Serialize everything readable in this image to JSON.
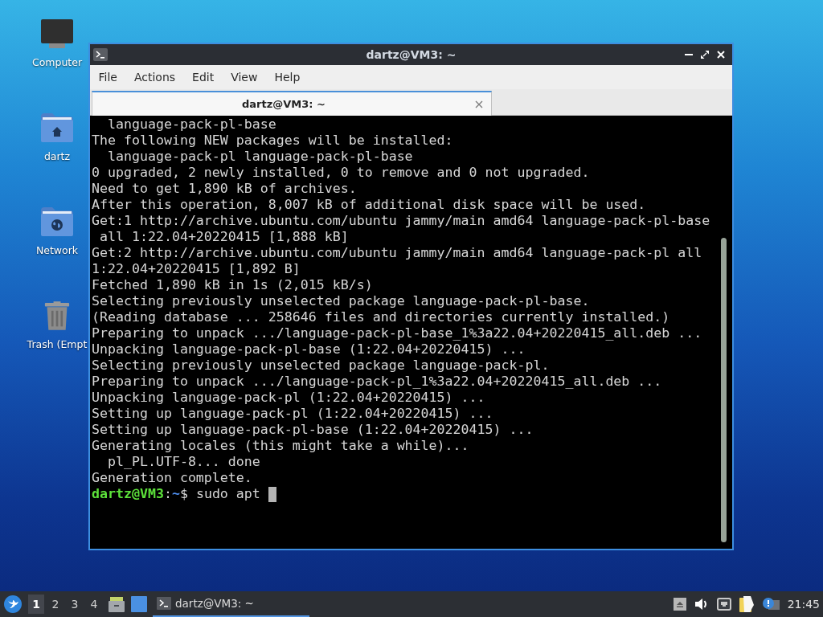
{
  "desktop": {
    "icons": [
      {
        "kind": "computer",
        "label": "Computer"
      },
      {
        "kind": "home",
        "label": "dartz"
      },
      {
        "kind": "network",
        "label": "Network"
      },
      {
        "kind": "trash",
        "label": "Trash (Empt"
      }
    ]
  },
  "window": {
    "title": "dartz@VM3: ~",
    "focused": true,
    "menu": [
      "File",
      "Actions",
      "Edit",
      "View",
      "Help"
    ],
    "tabs": [
      {
        "label": "dartz@VM3: ~",
        "selected": true
      }
    ],
    "terminal": {
      "lines": [
        "  language-pack-pl-base",
        "The following NEW packages will be installed:",
        "  language-pack-pl language-pack-pl-base",
        "0 upgraded, 2 newly installed, 0 to remove and 0 not upgraded.",
        "Need to get 1,890 kB of archives.",
        "After this operation, 8,007 kB of additional disk space will be used.",
        "Get:1 http://archive.ubuntu.com/ubuntu jammy/main amd64 language-pack-pl-base",
        " all 1:22.04+20220415 [1,888 kB]",
        "Get:2 http://archive.ubuntu.com/ubuntu jammy/main amd64 language-pack-pl all",
        "1:22.04+20220415 [1,892 B]",
        "Fetched 1,890 kB in 1s (2,015 kB/s)",
        "Selecting previously unselected package language-pack-pl-base.",
        "(Reading database ... 258646 files and directories currently installed.)",
        "Preparing to unpack .../language-pack-pl-base_1%3a22.04+20220415_all.deb ...",
        "Unpacking language-pack-pl-base (1:22.04+20220415) ...",
        "Selecting previously unselected package language-pack-pl.",
        "Preparing to unpack .../language-pack-pl_1%3a22.04+20220415_all.deb ...",
        "Unpacking language-pack-pl (1:22.04+20220415) ...",
        "Setting up language-pack-pl (1:22.04+20220415) ...",
        "Setting up language-pack-pl-base (1:22.04+20220415) ...",
        "Generating locales (this might take a while)...",
        "  pl_PL.UTF-8... done",
        "Generation complete."
      ],
      "prompt": {
        "user_host": "dartz@VM3",
        "separator": ":",
        "path": "~",
        "symbol": "$",
        "command": "sudo apt"
      },
      "cursor": true
    }
  },
  "taskbar": {
    "workspaces": [
      {
        "label": "1",
        "selected": true
      },
      {
        "label": "2",
        "selected": false
      },
      {
        "label": "3",
        "selected": false
      },
      {
        "label": "4",
        "selected": false
      }
    ],
    "tasks": [
      {
        "label": "dartz@VM3: ~",
        "selected": true
      }
    ],
    "clock": "21:45"
  }
}
